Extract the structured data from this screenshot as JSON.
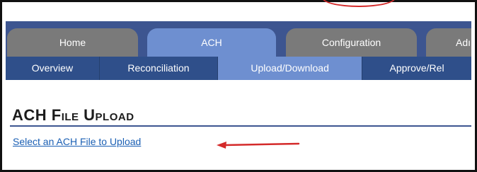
{
  "tabs": [
    {
      "label": "Home",
      "active": false
    },
    {
      "label": "ACH",
      "active": true
    },
    {
      "label": "Configuration",
      "active": false
    },
    {
      "label": "Adı",
      "active": false
    }
  ],
  "subnav": [
    {
      "label": "Overview",
      "active": false
    },
    {
      "label": "Reconciliation",
      "active": false
    },
    {
      "label": "Upload/Download",
      "active": true
    },
    {
      "label": "Approve/Rel",
      "active": false
    }
  ],
  "page": {
    "title": "ACH File Upload",
    "link_label": "Select an ACH File to Upload"
  },
  "colors": {
    "nav_bg": "#3d5590",
    "active_tab": "#6e8fd0",
    "inactive_tab": "#7a7a7a",
    "link": "#1a5fb4",
    "annotation": "#d42a2a"
  },
  "icons": {
    "annotation_arrow": "red-arrow-left-icon",
    "annotation_oval": "red-oval-annotation"
  }
}
